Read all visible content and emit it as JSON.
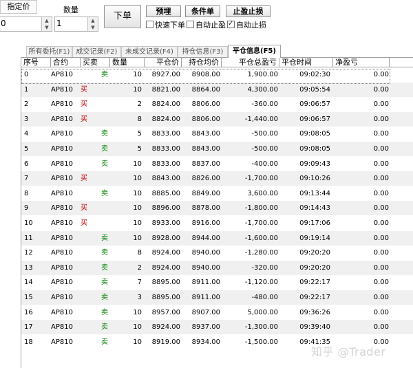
{
  "order_panel": {
    "price_type_label": "指定价",
    "qty_label": "数量",
    "price_value": "0",
    "qty_value": "1",
    "order_button": "下单",
    "preset_button": "预埋",
    "condition_button": "条件单",
    "stop_button": "止盈止损",
    "quick_order_label": "快速下单",
    "quick_order_checked": false,
    "auto_take_profit_label": "自动止盈",
    "auto_take_profit_checked": false,
    "auto_stop_loss_label": "自动止损",
    "auto_stop_loss_checked": true
  },
  "tabs": [
    {
      "label": "所有委托(F1)",
      "active": false
    },
    {
      "label": "成交记录(F2)",
      "active": false
    },
    {
      "label": "未成交记录(F4)",
      "active": false
    },
    {
      "label": "持仓信息(F3)",
      "active": false
    },
    {
      "label": "平仓信息(F5)",
      "active": true
    }
  ],
  "table": {
    "columns": [
      "序号",
      "合约",
      "买卖",
      "数量",
      "平仓价",
      "持仓均价",
      "平仓总盈亏",
      "平仓时间",
      "净盈亏"
    ],
    "rows": [
      [
        "0",
        "AP810",
        "卖",
        "10",
        "8927.00",
        "8908.00",
        "1,900.00",
        "09:02:30",
        "0.00"
      ],
      [
        "1",
        "AP810",
        "买",
        "10",
        "8821.00",
        "8864.00",
        "4,300.00",
        "09:05:54",
        "0.00"
      ],
      [
        "2",
        "AP810",
        "买",
        "2",
        "8824.00",
        "8806.00",
        "-360.00",
        "09:06:57",
        "0.00"
      ],
      [
        "3",
        "AP810",
        "买",
        "8",
        "8824.00",
        "8806.00",
        "-1,440.00",
        "09:06:57",
        "0.00"
      ],
      [
        "4",
        "AP810",
        "卖",
        "5",
        "8833.00",
        "8843.00",
        "-500.00",
        "09:08:05",
        "0.00"
      ],
      [
        "5",
        "AP810",
        "卖",
        "5",
        "8833.00",
        "8843.00",
        "-500.00",
        "09:08:05",
        "0.00"
      ],
      [
        "6",
        "AP810",
        "卖",
        "10",
        "8833.00",
        "8837.00",
        "-400.00",
        "09:09:43",
        "0.00"
      ],
      [
        "7",
        "AP810",
        "买",
        "10",
        "8843.00",
        "8826.00",
        "-1,700.00",
        "09:10:26",
        "0.00"
      ],
      [
        "8",
        "AP810",
        "卖",
        "10",
        "8885.00",
        "8849.00",
        "3,600.00",
        "09:13:44",
        "0.00"
      ],
      [
        "9",
        "AP810",
        "买",
        "10",
        "8896.00",
        "8878.00",
        "-1,800.00",
        "09:14:43",
        "0.00"
      ],
      [
        "10",
        "AP810",
        "买",
        "10",
        "8933.00",
        "8916.00",
        "-1,700.00",
        "09:17:06",
        "0.00"
      ],
      [
        "11",
        "AP810",
        "卖",
        "10",
        "8928.00",
        "8944.00",
        "-1,600.00",
        "09:19:14",
        "0.00"
      ],
      [
        "12",
        "AP810",
        "卖",
        "8",
        "8924.00",
        "8940.00",
        "-1,280.00",
        "09:20:20",
        "0.00"
      ],
      [
        "13",
        "AP810",
        "卖",
        "2",
        "8924.00",
        "8940.00",
        "-320.00",
        "09:20:20",
        "0.00"
      ],
      [
        "14",
        "AP810",
        "卖",
        "7",
        "8895.00",
        "8911.00",
        "-1,120.00",
        "09:22:17",
        "0.00"
      ],
      [
        "15",
        "AP810",
        "卖",
        "3",
        "8895.00",
        "8911.00",
        "-480.00",
        "09:22:17",
        "0.00"
      ],
      [
        "16",
        "AP810",
        "卖",
        "10",
        "8957.00",
        "8907.00",
        "5,000.00",
        "09:36:26",
        "0.00"
      ],
      [
        "17",
        "AP810",
        "卖",
        "10",
        "8924.00",
        "8937.00",
        "-1,300.00",
        "09:39:40",
        "0.00"
      ],
      [
        "18",
        "AP810",
        "卖",
        "10",
        "8919.00",
        "8934.00",
        "-1,500.00",
        "09:41:35",
        "0.00"
      ]
    ]
  },
  "colors": {
    "buy": "#c00000",
    "sell": "#008000",
    "row_alt": "#f0f0f0",
    "grid_line": "#a0a0a0"
  },
  "watermark": "知乎 @Trader"
}
